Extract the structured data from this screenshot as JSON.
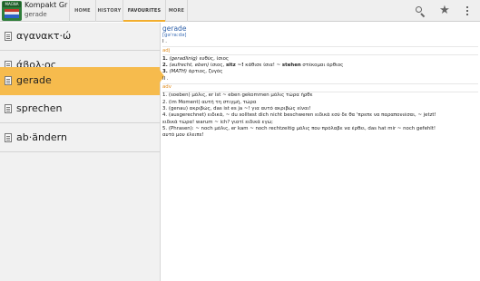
{
  "app": {
    "icon_label": "MAGNA",
    "title": "Kompakt Gr",
    "subtitle": "gerade"
  },
  "tabs": [
    {
      "label": "HOME"
    },
    {
      "label": "HISTORY"
    },
    {
      "label": "FAVOURITES",
      "active": true
    },
    {
      "label": "MORE"
    }
  ],
  "actions": {
    "search_icon": "search-icon",
    "favourite_icon": "star-icon",
    "overflow_icon": "overflow-menu-icon"
  },
  "list": {
    "items": [
      {
        "label": "αγανακτ·ώ"
      },
      {
        "label": "άβολ·ος"
      },
      {
        "label": "gerade",
        "selected": true
      },
      {
        "label": "sprechen"
      },
      {
        "label": "ab·ändern"
      }
    ]
  },
  "entry": {
    "headword": "gerade",
    "pronunciation": "[gəˈraːdə]",
    "roman_1": "I .",
    "pos_adj": "adj",
    "adj_senses": [
      {
        "num": "1.",
        "gloss": "(geradlinig)",
        "text": " ευθύς, ίσιος"
      },
      {
        "num": "2.",
        "gloss": "(aufrecht, eben)",
        "text": " ίσιος, ",
        "bold": "sitz ~!",
        "text2": " κάθισε ίσια! ~ ",
        "bold2": "stehen",
        "text3": " στέκομαι όρθιος"
      },
      {
        "num": "3.",
        "gloss": "(MATH)",
        "text": " άρτιος, ζυγός"
      }
    ],
    "roman_2": "II .",
    "pos_adv": "adv",
    "adv_senses": [
      {
        "line": "1. (soeben) μόλις, er ist ~ eben gekommen μόλις τώρα ήρθε"
      },
      {
        "line": "2. (im Moment) αυτή τη στιγμή, τώρα"
      },
      {
        "line": "3. (genau) ακριβώς, das ist es ja ~! για αυτό ακριβώς είναι!"
      },
      {
        "line": "4. (ausgerechnet) ειδικά, ~ du solltest dich nicht beschweren ειδικά εσύ δε θα 'πρεπε να παραπονιέσαι, ~ jetzt!"
      },
      {
        "line": "ειδικά τώρα! warum ~ ich? γιατί ειδικά εγώ;"
      },
      {
        "line": "5. (Phrasen): ~ noch μόλις, er kam ~ noch rechtzeitig μόλις που πρόλαβε να έρθει, das hat mir ~ noch gefehlt!"
      },
      {
        "line": "αυτό μου έλειπε!"
      }
    ]
  }
}
